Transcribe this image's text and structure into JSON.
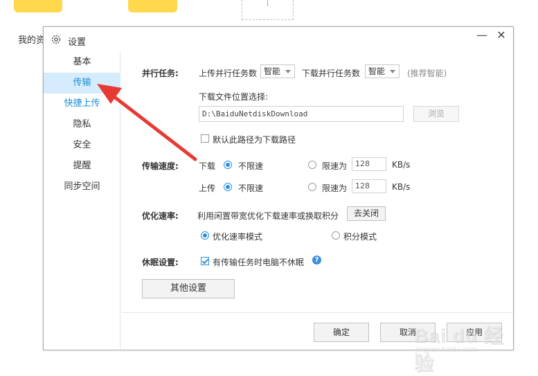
{
  "background": {
    "left_text": "我的资"
  },
  "dialog": {
    "title": "设置",
    "icon": "gear-icon",
    "minimize_label": "—",
    "close_label": "✕"
  },
  "sidebar": {
    "items": [
      {
        "label": "基本"
      },
      {
        "label": "传输",
        "active": true
      },
      {
        "label": "快捷上传"
      },
      {
        "label": "隐私"
      },
      {
        "label": "安全"
      },
      {
        "label": "提醒"
      },
      {
        "label": "同步空间"
      }
    ]
  },
  "parallel": {
    "section_label": "并行任务:",
    "upload_label": "上传并行任务数",
    "upload_value": "智能",
    "download_label": "下载并行任务数",
    "download_value": "智能",
    "hint": "(推荐智能)"
  },
  "download_location": {
    "label": "下载文件位置选择:",
    "path": "D:\\BaiduNetdiskDownload",
    "browse_label": "浏览",
    "default_checkbox_label": "默认此路径为下载路径",
    "default_checked": false
  },
  "speed": {
    "section_label": "传输速度:",
    "download": {
      "label": "下载",
      "unlimited_label": "不限速",
      "limit_label": "限速为",
      "limit_value": "128",
      "unit": "KB/s",
      "selected": "unlimited"
    },
    "upload": {
      "label": "上传",
      "unlimited_label": "不限速",
      "limit_label": "限速为",
      "limit_value": "128",
      "unit": "KB/s",
      "selected": "unlimited"
    }
  },
  "optimize": {
    "section_label": "优化速率:",
    "description": "利用闲置带宽优化下载速率或换取积分",
    "toggle_button": "去关闭",
    "mode_speed_label": "优化速率模式",
    "mode_points_label": "积分模式",
    "selected": "speed"
  },
  "sleep": {
    "section_label": "休眠设置:",
    "checkbox_label": "有传输任务时电脑不休眠",
    "checked": true,
    "help_icon": "?"
  },
  "other_settings_label": "其他设置",
  "footer": {
    "ok_label": "确定",
    "cancel_label": "取消",
    "apply_label": "应用"
  },
  "watermark": {
    "text": "Bai du 经验",
    "sub": "jingyan.baidu.com"
  },
  "colors": {
    "accent": "#2a8ee0",
    "active_bg": "#d4ecfc",
    "arrow": "#e83a35",
    "tile": "#ffd84e"
  }
}
